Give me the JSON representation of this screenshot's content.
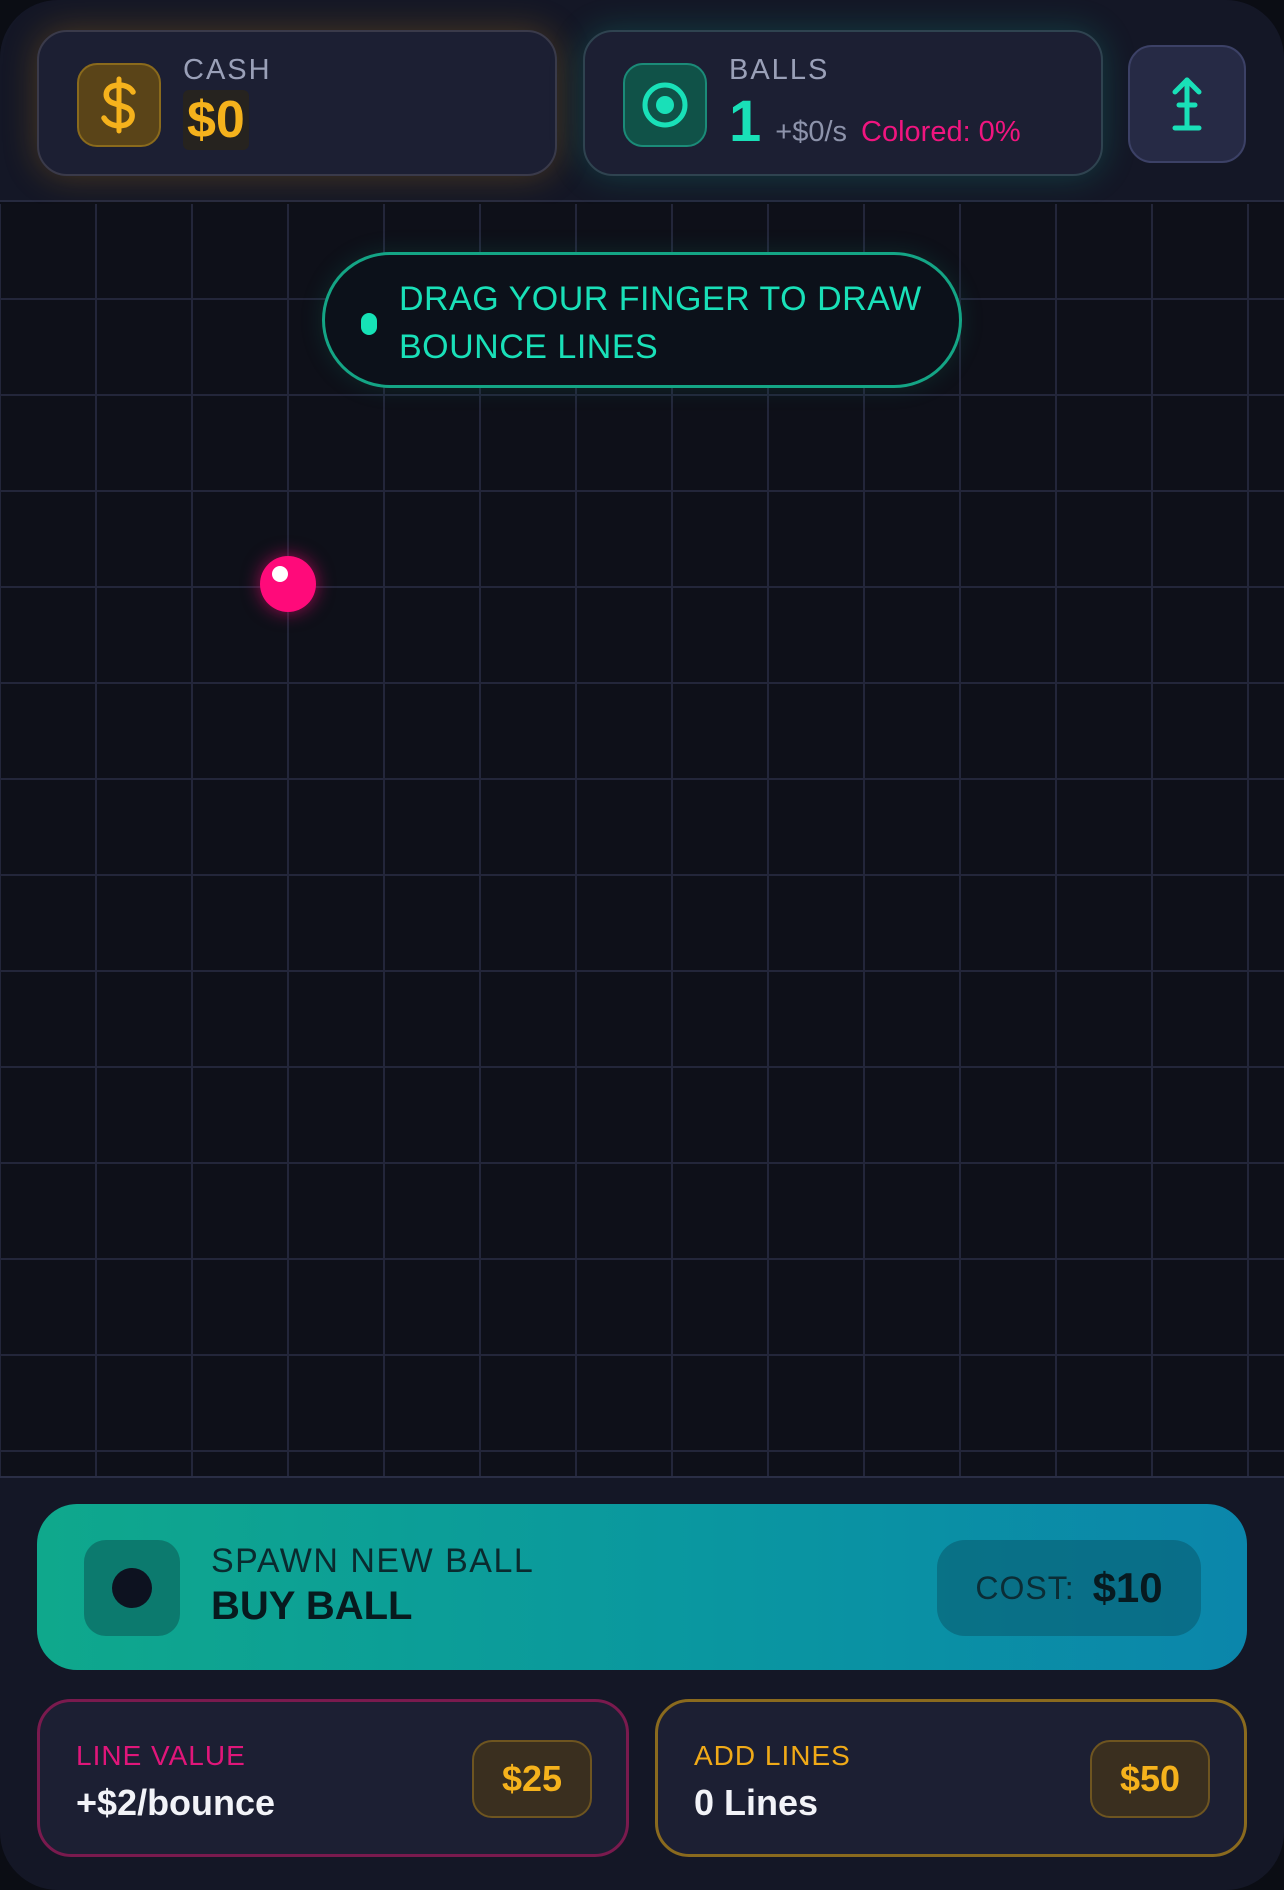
{
  "hud": {
    "cash": {
      "label": "CASH",
      "value": "$0",
      "icon": "dollar-icon"
    },
    "balls": {
      "label": "BALLS",
      "count": "1",
      "rate": "+$0/s",
      "colored": "Colored: 0%",
      "icon": "target-icon"
    },
    "height_button_icon": "vertical-arrow-icon"
  },
  "field": {
    "hint": "DRAG YOUR FINGER TO DRAW BOUNCE LINES"
  },
  "panel": {
    "buy_ball": {
      "subtitle": "SPAWN NEW BALL",
      "title": "BUY BALL",
      "cost_label": "COST:",
      "cost_value": "$10"
    },
    "line_value": {
      "label": "LINE VALUE",
      "value": "+$2/bounce",
      "price": "$25"
    },
    "add_lines": {
      "label": "ADD LINES",
      "value": "0 Lines",
      "price": "$50"
    }
  },
  "colors": {
    "accent_teal": "#19e0b8",
    "accent_gold": "#f5b21c",
    "accent_pink": "#ff0a7a",
    "background": "#0e1019"
  }
}
